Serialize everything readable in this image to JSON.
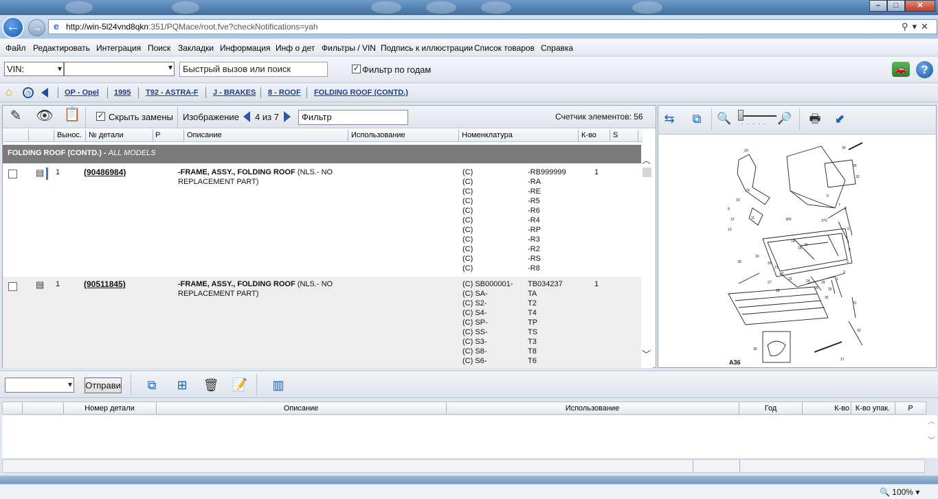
{
  "browser": {
    "url_host": "http://win-5l24vnd8qkn",
    "url_rest": ":351/PQMace/root.fve?checkNotifications=yah",
    "zoom": "100%"
  },
  "menu": [
    "Файл",
    "Редактировать",
    "Интеграция",
    "Поиск",
    "Закладки",
    "Информация",
    "Инф о дет",
    "Фильтры / VIN",
    "Подпись к иллюстрации",
    "Список товаров",
    "Справка"
  ],
  "toolbar": {
    "vin_label": "VIN:",
    "quick_search_placeholder": "Быстрый вызов или поиск",
    "year_filter_label": "Фильтр по годам",
    "year_filter_checked": "✓"
  },
  "breadcrumb": [
    "OP - Opel",
    "1995",
    "T92 - ASTRA-F",
    "J - BRAKES",
    "8 - ROOF",
    "FOLDING ROOF (CONTD.)"
  ],
  "parts": {
    "hide_replacements_label": "Скрыть замены",
    "hide_replacements_checked": "✓",
    "image_label": "Изображение",
    "image_counter": "4 из 7",
    "filter_placeholder": "Фильтр",
    "element_count": "Счетчик элементов: 56",
    "columns": [
      "Вынос.",
      "№ детали",
      "P",
      "Описание",
      "Использование",
      "Номенклатура",
      "К-во",
      "S"
    ],
    "group_title": "FOLDING ROOF (CONTD.) - ",
    "group_subtitle": "ALL MODELS",
    "rows": [
      {
        "callout": "1",
        "part_no": "(90486984)",
        "desc_bold": "-FRAME, ASSY., FOLDING ROOF",
        "desc_rest": " (NLS.- NO REPLACEMENT PART)",
        "qty": "1",
        "nomen_a": [
          "(C)",
          "(C)",
          "(C)",
          "(C)",
          "(C)",
          "(C)",
          "(C)",
          "(C)",
          "(C)",
          "(C)",
          "(C)"
        ],
        "nomen_b": [
          "-RB999999",
          "-RA",
          "-RE",
          "-R5",
          "-R6",
          "-R4",
          "-RP",
          "-R3",
          "-R2",
          "-RS",
          "-R8"
        ]
      },
      {
        "callout": "1",
        "part_no": "(90511845)",
        "desc_bold": "-FRAME, ASSY., FOLDING ROOF",
        "desc_rest": " (NLS.- NO REPLACEMENT PART)",
        "qty": "1",
        "nomen_a": [
          "(C) SB000001-",
          "(C) SA-",
          "(C) S2-",
          "(C) S4-",
          "(C) SP-",
          "(C) SS-",
          "(C) S3-",
          "(C) S8-",
          "(C) S6-"
        ],
        "nomen_b": [
          "TB034237",
          "TA",
          "T2",
          "T4",
          "TP",
          "TS",
          "T3",
          "T8",
          "T6"
        ]
      }
    ]
  },
  "illustration": {
    "label": "A36",
    "callouts": [
      "2X",
      "34",
      "35",
      "33",
      "2X",
      "9",
      "10",
      "11",
      "12",
      "13",
      "30X",
      "37X",
      "7",
      "8",
      "6",
      "5",
      "4",
      "3",
      "2",
      "1",
      "14",
      "15",
      "16",
      "17",
      "18",
      "19",
      "20",
      "21",
      "22",
      "23",
      "24",
      "25",
      "26",
      "27",
      "28",
      "29",
      "30",
      "31",
      "32",
      "36"
    ]
  },
  "cart": {
    "send_label": "Отправи",
    "columns": [
      "Номер детали",
      "Описание",
      "Использование",
      "Год",
      "К-во",
      "К-во упак.",
      "P"
    ]
  }
}
